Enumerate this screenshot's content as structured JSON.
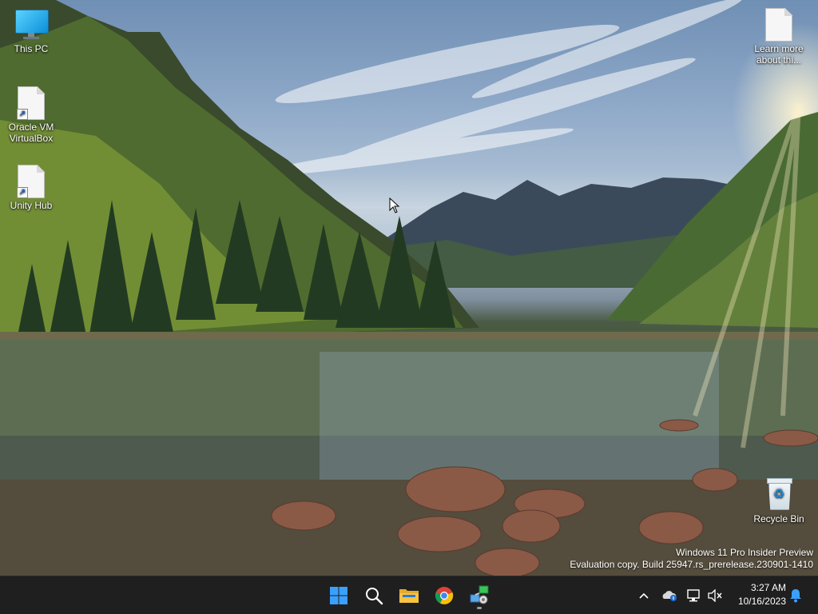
{
  "desktop": {
    "icons": [
      {
        "label": "This PC",
        "icon": "this-pc-icon"
      },
      {
        "label": "Oracle VM VirtualBox",
        "icon": "shortcut-file-icon"
      },
      {
        "label": "Unity Hub",
        "icon": "shortcut-file-icon"
      },
      {
        "label": "Learn more about thi...",
        "icon": "file-icon"
      },
      {
        "label": "Recycle Bin",
        "icon": "recycle-bin-icon"
      }
    ],
    "watermark": {
      "line1": "Windows 11 Pro Insider Preview",
      "line2": "Evaluation copy. Build 25947.rs_prerelease.230901-1410"
    }
  },
  "taskbar": {
    "apps": [
      {
        "name": "Start",
        "icon": "windows-start-icon"
      },
      {
        "name": "Search",
        "icon": "search-icon"
      },
      {
        "name": "File Explorer",
        "icon": "folder-icon"
      },
      {
        "name": "Google Chrome",
        "icon": "chrome-icon"
      },
      {
        "name": "Network app",
        "icon": "network-app-icon"
      }
    ],
    "tray": {
      "overflow_icon": "chevron-up-icon",
      "icons": [
        "onedrive-icon",
        "network-icon",
        "volume-muted-icon"
      ],
      "time": "3:27 AM",
      "date": "10/16/2023",
      "notification_icon": "bell-icon"
    }
  },
  "colors": {
    "taskbar_bg": "#1f1f1f",
    "windows_blue": "#1e90ff",
    "chrome_red": "#db4437",
    "chrome_yellow": "#f4c20d",
    "chrome_green": "#0f9d58",
    "folder_yellow": "#f6c342",
    "accent_blue": "#3aa0ff"
  }
}
